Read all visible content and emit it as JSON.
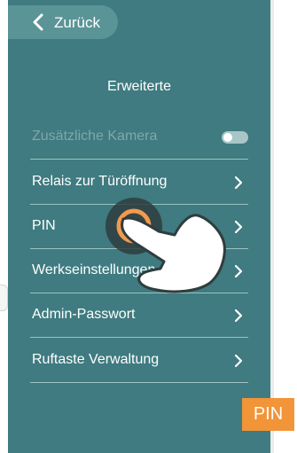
{
  "header": {
    "back_label": "Zurück",
    "title": "Erweiterte"
  },
  "menu": {
    "items": [
      {
        "label": "Zusätzliche Kamera",
        "type": "toggle",
        "enabled": false,
        "toggle_on": false
      },
      {
        "label": "Relais zur Türöffnung",
        "type": "link"
      },
      {
        "label": "PIN",
        "type": "link"
      },
      {
        "label": "Werkseinstellungen",
        "type": "link"
      },
      {
        "label": "Admin-Passwort",
        "type": "link"
      },
      {
        "label": "Ruftaste Verwaltung",
        "type": "link"
      }
    ]
  },
  "overlay": {
    "badge_label": "PIN",
    "gesture_icon": "tap-hand-icon"
  },
  "colors": {
    "background": "#3f7b80",
    "back_button": "#5b9496",
    "divider": "#9cc3c4",
    "badge": "#f29438",
    "tap_ring": "#f39a4b"
  }
}
